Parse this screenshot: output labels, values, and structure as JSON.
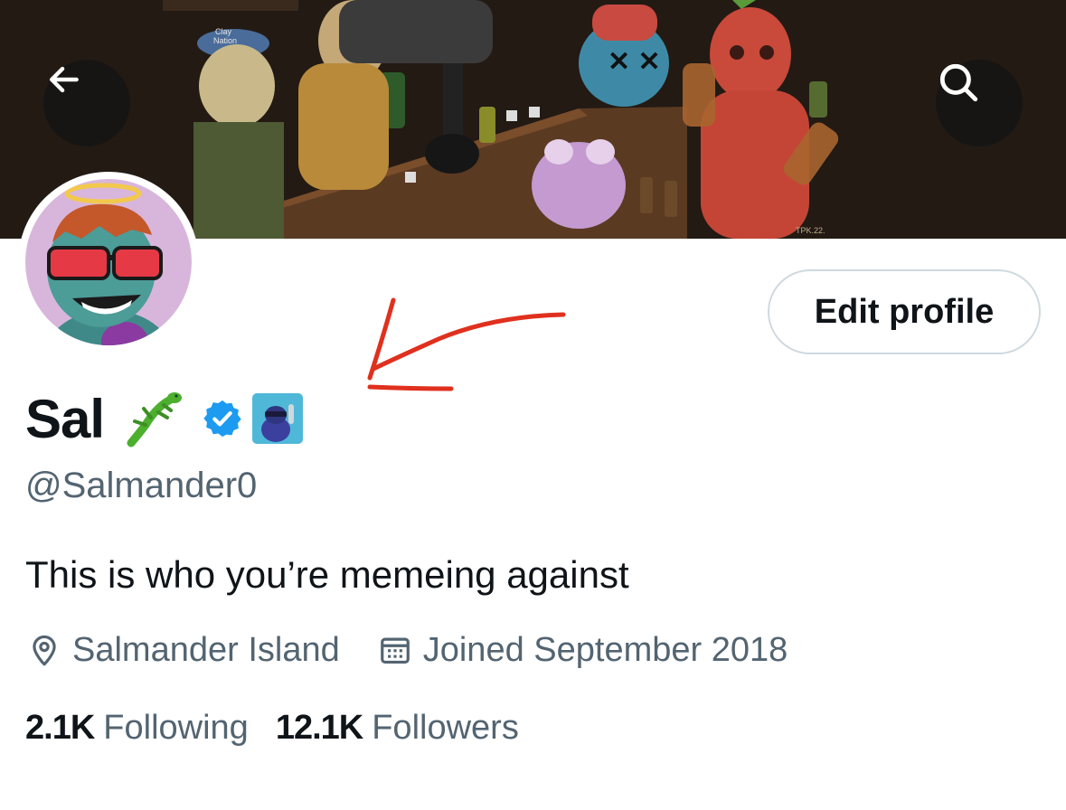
{
  "profile": {
    "display_name": "Sal",
    "handle": "@Salmander0",
    "bio": "This is who you’re memeing against",
    "location": "Salmander Island",
    "joined": "Joined September 2018",
    "edit_profile_label": "Edit profile"
  },
  "stats": {
    "following_count": "2.1K",
    "following_label": "Following",
    "followers_count": "12.1K",
    "followers_label": "Followers"
  },
  "banner": {
    "cap_text_line1": "Clay",
    "cap_text_line2": "Nation",
    "signature": "TPK.22."
  },
  "icons": {
    "back": "arrow-left-icon",
    "search": "search-icon",
    "verified": "verified-badge-icon",
    "affiliate": "affiliate-badge-icon",
    "lizard": "lizard-emoji-icon",
    "location": "location-pin-icon",
    "calendar": "calendar-icon"
  },
  "colors": {
    "verified_blue": "#1d9bf0",
    "annotation_red": "#e0301e",
    "secondary_text": "#536471",
    "primary_text": "#0f1419",
    "border": "#cfd9de"
  }
}
